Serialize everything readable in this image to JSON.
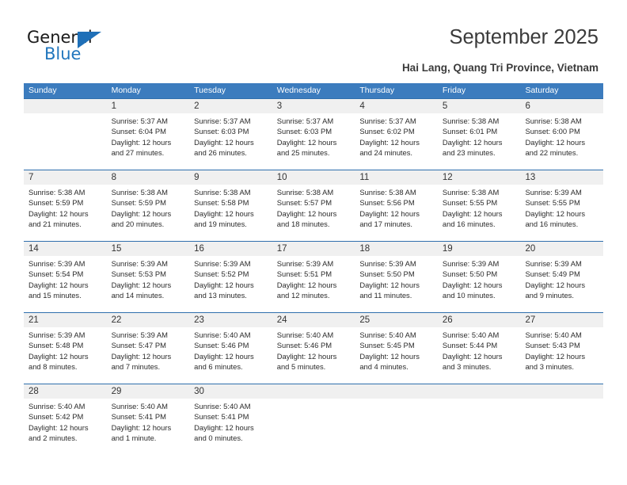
{
  "brand": {
    "name_top": "General",
    "name_bottom": "Blue",
    "triangle_icon": "triangle-icon",
    "accent_color": "#1f70b8"
  },
  "header": {
    "title": "September 2025",
    "subtitle": "Hai Lang, Quang Tri Province, Vietnam"
  },
  "calendar": {
    "header_bg": "#3c7cbe",
    "row_divider": "#2f6fad",
    "daynum_band": "#f0f0f0",
    "weekdays": [
      "Sunday",
      "Monday",
      "Tuesday",
      "Wednesday",
      "Thursday",
      "Friday",
      "Saturday"
    ],
    "weeks": [
      [
        {
          "day": "",
          "empty": true
        },
        {
          "day": "1",
          "sunrise": "Sunrise: 5:37 AM",
          "sunset": "Sunset: 6:04 PM",
          "daylight1": "Daylight: 12 hours",
          "daylight2": "and 27 minutes."
        },
        {
          "day": "2",
          "sunrise": "Sunrise: 5:37 AM",
          "sunset": "Sunset: 6:03 PM",
          "daylight1": "Daylight: 12 hours",
          "daylight2": "and 26 minutes."
        },
        {
          "day": "3",
          "sunrise": "Sunrise: 5:37 AM",
          "sunset": "Sunset: 6:03 PM",
          "daylight1": "Daylight: 12 hours",
          "daylight2": "and 25 minutes."
        },
        {
          "day": "4",
          "sunrise": "Sunrise: 5:37 AM",
          "sunset": "Sunset: 6:02 PM",
          "daylight1": "Daylight: 12 hours",
          "daylight2": "and 24 minutes."
        },
        {
          "day": "5",
          "sunrise": "Sunrise: 5:38 AM",
          "sunset": "Sunset: 6:01 PM",
          "daylight1": "Daylight: 12 hours",
          "daylight2": "and 23 minutes."
        },
        {
          "day": "6",
          "sunrise": "Sunrise: 5:38 AM",
          "sunset": "Sunset: 6:00 PM",
          "daylight1": "Daylight: 12 hours",
          "daylight2": "and 22 minutes."
        }
      ],
      [
        {
          "day": "7",
          "sunrise": "Sunrise: 5:38 AM",
          "sunset": "Sunset: 5:59 PM",
          "daylight1": "Daylight: 12 hours",
          "daylight2": "and 21 minutes."
        },
        {
          "day": "8",
          "sunrise": "Sunrise: 5:38 AM",
          "sunset": "Sunset: 5:59 PM",
          "daylight1": "Daylight: 12 hours",
          "daylight2": "and 20 minutes."
        },
        {
          "day": "9",
          "sunrise": "Sunrise: 5:38 AM",
          "sunset": "Sunset: 5:58 PM",
          "daylight1": "Daylight: 12 hours",
          "daylight2": "and 19 minutes."
        },
        {
          "day": "10",
          "sunrise": "Sunrise: 5:38 AM",
          "sunset": "Sunset: 5:57 PM",
          "daylight1": "Daylight: 12 hours",
          "daylight2": "and 18 minutes."
        },
        {
          "day": "11",
          "sunrise": "Sunrise: 5:38 AM",
          "sunset": "Sunset: 5:56 PM",
          "daylight1": "Daylight: 12 hours",
          "daylight2": "and 17 minutes."
        },
        {
          "day": "12",
          "sunrise": "Sunrise: 5:38 AM",
          "sunset": "Sunset: 5:55 PM",
          "daylight1": "Daylight: 12 hours",
          "daylight2": "and 16 minutes."
        },
        {
          "day": "13",
          "sunrise": "Sunrise: 5:39 AM",
          "sunset": "Sunset: 5:55 PM",
          "daylight1": "Daylight: 12 hours",
          "daylight2": "and 16 minutes."
        }
      ],
      [
        {
          "day": "14",
          "sunrise": "Sunrise: 5:39 AM",
          "sunset": "Sunset: 5:54 PM",
          "daylight1": "Daylight: 12 hours",
          "daylight2": "and 15 minutes."
        },
        {
          "day": "15",
          "sunrise": "Sunrise: 5:39 AM",
          "sunset": "Sunset: 5:53 PM",
          "daylight1": "Daylight: 12 hours",
          "daylight2": "and 14 minutes."
        },
        {
          "day": "16",
          "sunrise": "Sunrise: 5:39 AM",
          "sunset": "Sunset: 5:52 PM",
          "daylight1": "Daylight: 12 hours",
          "daylight2": "and 13 minutes."
        },
        {
          "day": "17",
          "sunrise": "Sunrise: 5:39 AM",
          "sunset": "Sunset: 5:51 PM",
          "daylight1": "Daylight: 12 hours",
          "daylight2": "and 12 minutes."
        },
        {
          "day": "18",
          "sunrise": "Sunrise: 5:39 AM",
          "sunset": "Sunset: 5:50 PM",
          "daylight1": "Daylight: 12 hours",
          "daylight2": "and 11 minutes."
        },
        {
          "day": "19",
          "sunrise": "Sunrise: 5:39 AM",
          "sunset": "Sunset: 5:50 PM",
          "daylight1": "Daylight: 12 hours",
          "daylight2": "and 10 minutes."
        },
        {
          "day": "20",
          "sunrise": "Sunrise: 5:39 AM",
          "sunset": "Sunset: 5:49 PM",
          "daylight1": "Daylight: 12 hours",
          "daylight2": "and 9 minutes."
        }
      ],
      [
        {
          "day": "21",
          "sunrise": "Sunrise: 5:39 AM",
          "sunset": "Sunset: 5:48 PM",
          "daylight1": "Daylight: 12 hours",
          "daylight2": "and 8 minutes."
        },
        {
          "day": "22",
          "sunrise": "Sunrise: 5:39 AM",
          "sunset": "Sunset: 5:47 PM",
          "daylight1": "Daylight: 12 hours",
          "daylight2": "and 7 minutes."
        },
        {
          "day": "23",
          "sunrise": "Sunrise: 5:40 AM",
          "sunset": "Sunset: 5:46 PM",
          "daylight1": "Daylight: 12 hours",
          "daylight2": "and 6 minutes."
        },
        {
          "day": "24",
          "sunrise": "Sunrise: 5:40 AM",
          "sunset": "Sunset: 5:46 PM",
          "daylight1": "Daylight: 12 hours",
          "daylight2": "and 5 minutes."
        },
        {
          "day": "25",
          "sunrise": "Sunrise: 5:40 AM",
          "sunset": "Sunset: 5:45 PM",
          "daylight1": "Daylight: 12 hours",
          "daylight2": "and 4 minutes."
        },
        {
          "day": "26",
          "sunrise": "Sunrise: 5:40 AM",
          "sunset": "Sunset: 5:44 PM",
          "daylight1": "Daylight: 12 hours",
          "daylight2": "and 3 minutes."
        },
        {
          "day": "27",
          "sunrise": "Sunrise: 5:40 AM",
          "sunset": "Sunset: 5:43 PM",
          "daylight1": "Daylight: 12 hours",
          "daylight2": "and 3 minutes."
        }
      ],
      [
        {
          "day": "28",
          "sunrise": "Sunrise: 5:40 AM",
          "sunset": "Sunset: 5:42 PM",
          "daylight1": "Daylight: 12 hours",
          "daylight2": "and 2 minutes."
        },
        {
          "day": "29",
          "sunrise": "Sunrise: 5:40 AM",
          "sunset": "Sunset: 5:41 PM",
          "daylight1": "Daylight: 12 hours",
          "daylight2": "and 1 minute."
        },
        {
          "day": "30",
          "sunrise": "Sunrise: 5:40 AM",
          "sunset": "Sunset: 5:41 PM",
          "daylight1": "Daylight: 12 hours",
          "daylight2": "and 0 minutes."
        },
        {
          "day": "",
          "empty": true
        },
        {
          "day": "",
          "empty": true
        },
        {
          "day": "",
          "empty": true
        },
        {
          "day": "",
          "empty": true
        }
      ]
    ]
  }
}
